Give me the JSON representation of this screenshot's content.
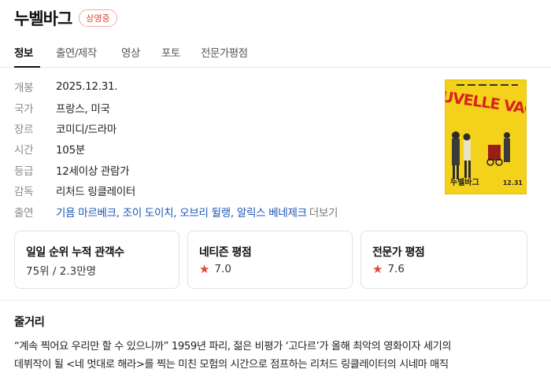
{
  "movie": {
    "title": "누벨바그",
    "status_badge": "상영중"
  },
  "tabs": [
    {
      "label": "정보",
      "active": true
    },
    {
      "label": "출연/제작",
      "active": false
    },
    {
      "label": "영상",
      "active": false
    },
    {
      "label": "포토",
      "active": false
    },
    {
      "label": "전문가평점",
      "active": false
    }
  ],
  "info": {
    "release": {
      "label": "개봉",
      "value": "2025.12.31."
    },
    "country": {
      "label": "국가",
      "value": "프랑스, 미국"
    },
    "genre": {
      "label": "장르",
      "value": "코미디/드라마"
    },
    "runtime": {
      "label": "시간",
      "value": "105분"
    },
    "rating": {
      "label": "등급",
      "value": "12세이상 관람가"
    },
    "director": {
      "label": "감독",
      "value": "리처드 링클레이터"
    },
    "cast": {
      "label": "출연",
      "names": [
        "기욤 마르베크",
        "조이 도이치",
        "오브리 뒬랭",
        "알릭스 베네제크"
      ],
      "separator": ", ",
      "more": "더보기"
    }
  },
  "poster": {
    "title_art": "NOUVELLE VAGUE",
    "kr_title": "누벨바그",
    "date": "12.31",
    "colors": {
      "bg": "#f4d21b",
      "text": "#d8231f"
    }
  },
  "cards": [
    {
      "title": "일일 순위  누적 관객수",
      "value": "75위 / 2.3만명",
      "star": false
    },
    {
      "title": "네티즌 평점",
      "value": "7.0",
      "star": true
    },
    {
      "title": "전문가 평점",
      "value": "7.6",
      "star": true
    }
  ],
  "synopsis": {
    "title": "줄거리",
    "lines": [
      "“계속 찍어요 우리만 할 수 있으니까” 1959년 파리, 젊은 비평가 ‘고다르’가 올해 최악의 영화이자 세기의",
      "데뷔작이 될 <네 멋대로 해라>를 찍는 미친 모험의 시간으로 점프하는 리처드 링클레이터의 시네마 매직"
    ]
  },
  "colors": {
    "accent_red": "#e0463b",
    "link_blue": "#1a55b8"
  }
}
